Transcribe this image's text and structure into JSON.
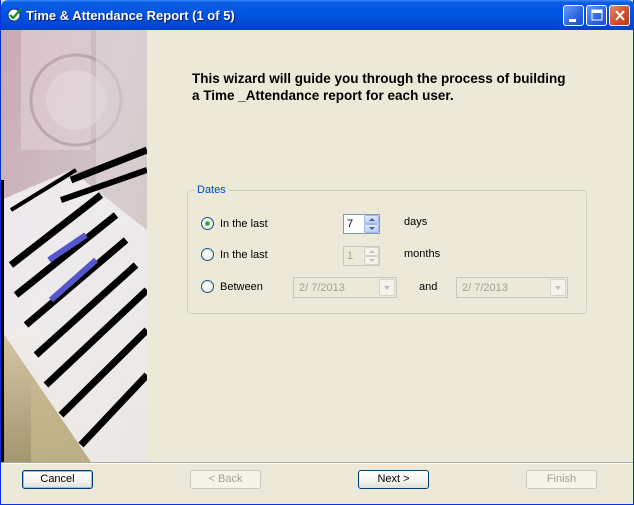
{
  "window": {
    "title": "Time & Attendance Report (1 of 5)"
  },
  "intro": {
    "line1": "This wizard will guide you through the process of building",
    "line2": "a Time _Attendance report for each user."
  },
  "dates_group": {
    "label": "Dates",
    "options": [
      {
        "label": "In the last",
        "value": "7",
        "unit": "days",
        "selected": true
      },
      {
        "label": "In the last",
        "value": "1",
        "unit": "months",
        "selected": false
      },
      {
        "label": "Between",
        "from": "2/  7/2013",
        "and_label": "and",
        "to": "2/  7/2013",
        "selected": false
      }
    ]
  },
  "buttons": {
    "cancel": "Cancel",
    "back": "< Back",
    "next": "Next >",
    "finish": "Finish"
  },
  "colors": {
    "titlebar": "#0054e3",
    "group_label": "#0046d5",
    "face": "#ece9d8"
  }
}
